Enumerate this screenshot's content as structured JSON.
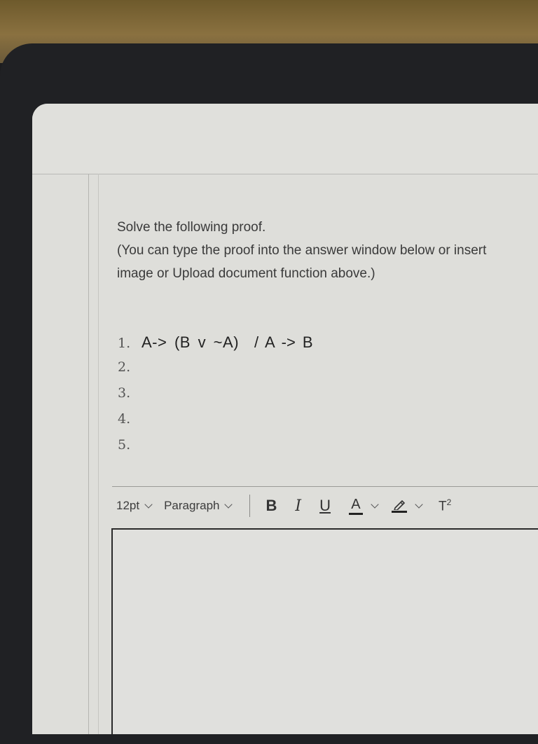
{
  "question": {
    "line1": "Solve the following proof.",
    "line2": "(You can type the proof into the answer window below or insert",
    "line3": "image or Upload document function above.)"
  },
  "proof": [
    {
      "num": "1.",
      "statement": "A-> (B v ~A)",
      "conclusion": "/ A -> B"
    },
    {
      "num": "2.",
      "statement": "",
      "conclusion": ""
    },
    {
      "num": "3.",
      "statement": "",
      "conclusion": ""
    },
    {
      "num": "4.",
      "statement": "",
      "conclusion": ""
    },
    {
      "num": "5.",
      "statement": "",
      "conclusion": ""
    }
  ],
  "toolbar": {
    "font_size": "12pt",
    "block_format": "Paragraph",
    "bold": "B",
    "italic": "I",
    "underline": "U",
    "text_color": "A",
    "superscript_base": "T",
    "superscript_exp": "2"
  },
  "editor": {
    "value": ""
  }
}
